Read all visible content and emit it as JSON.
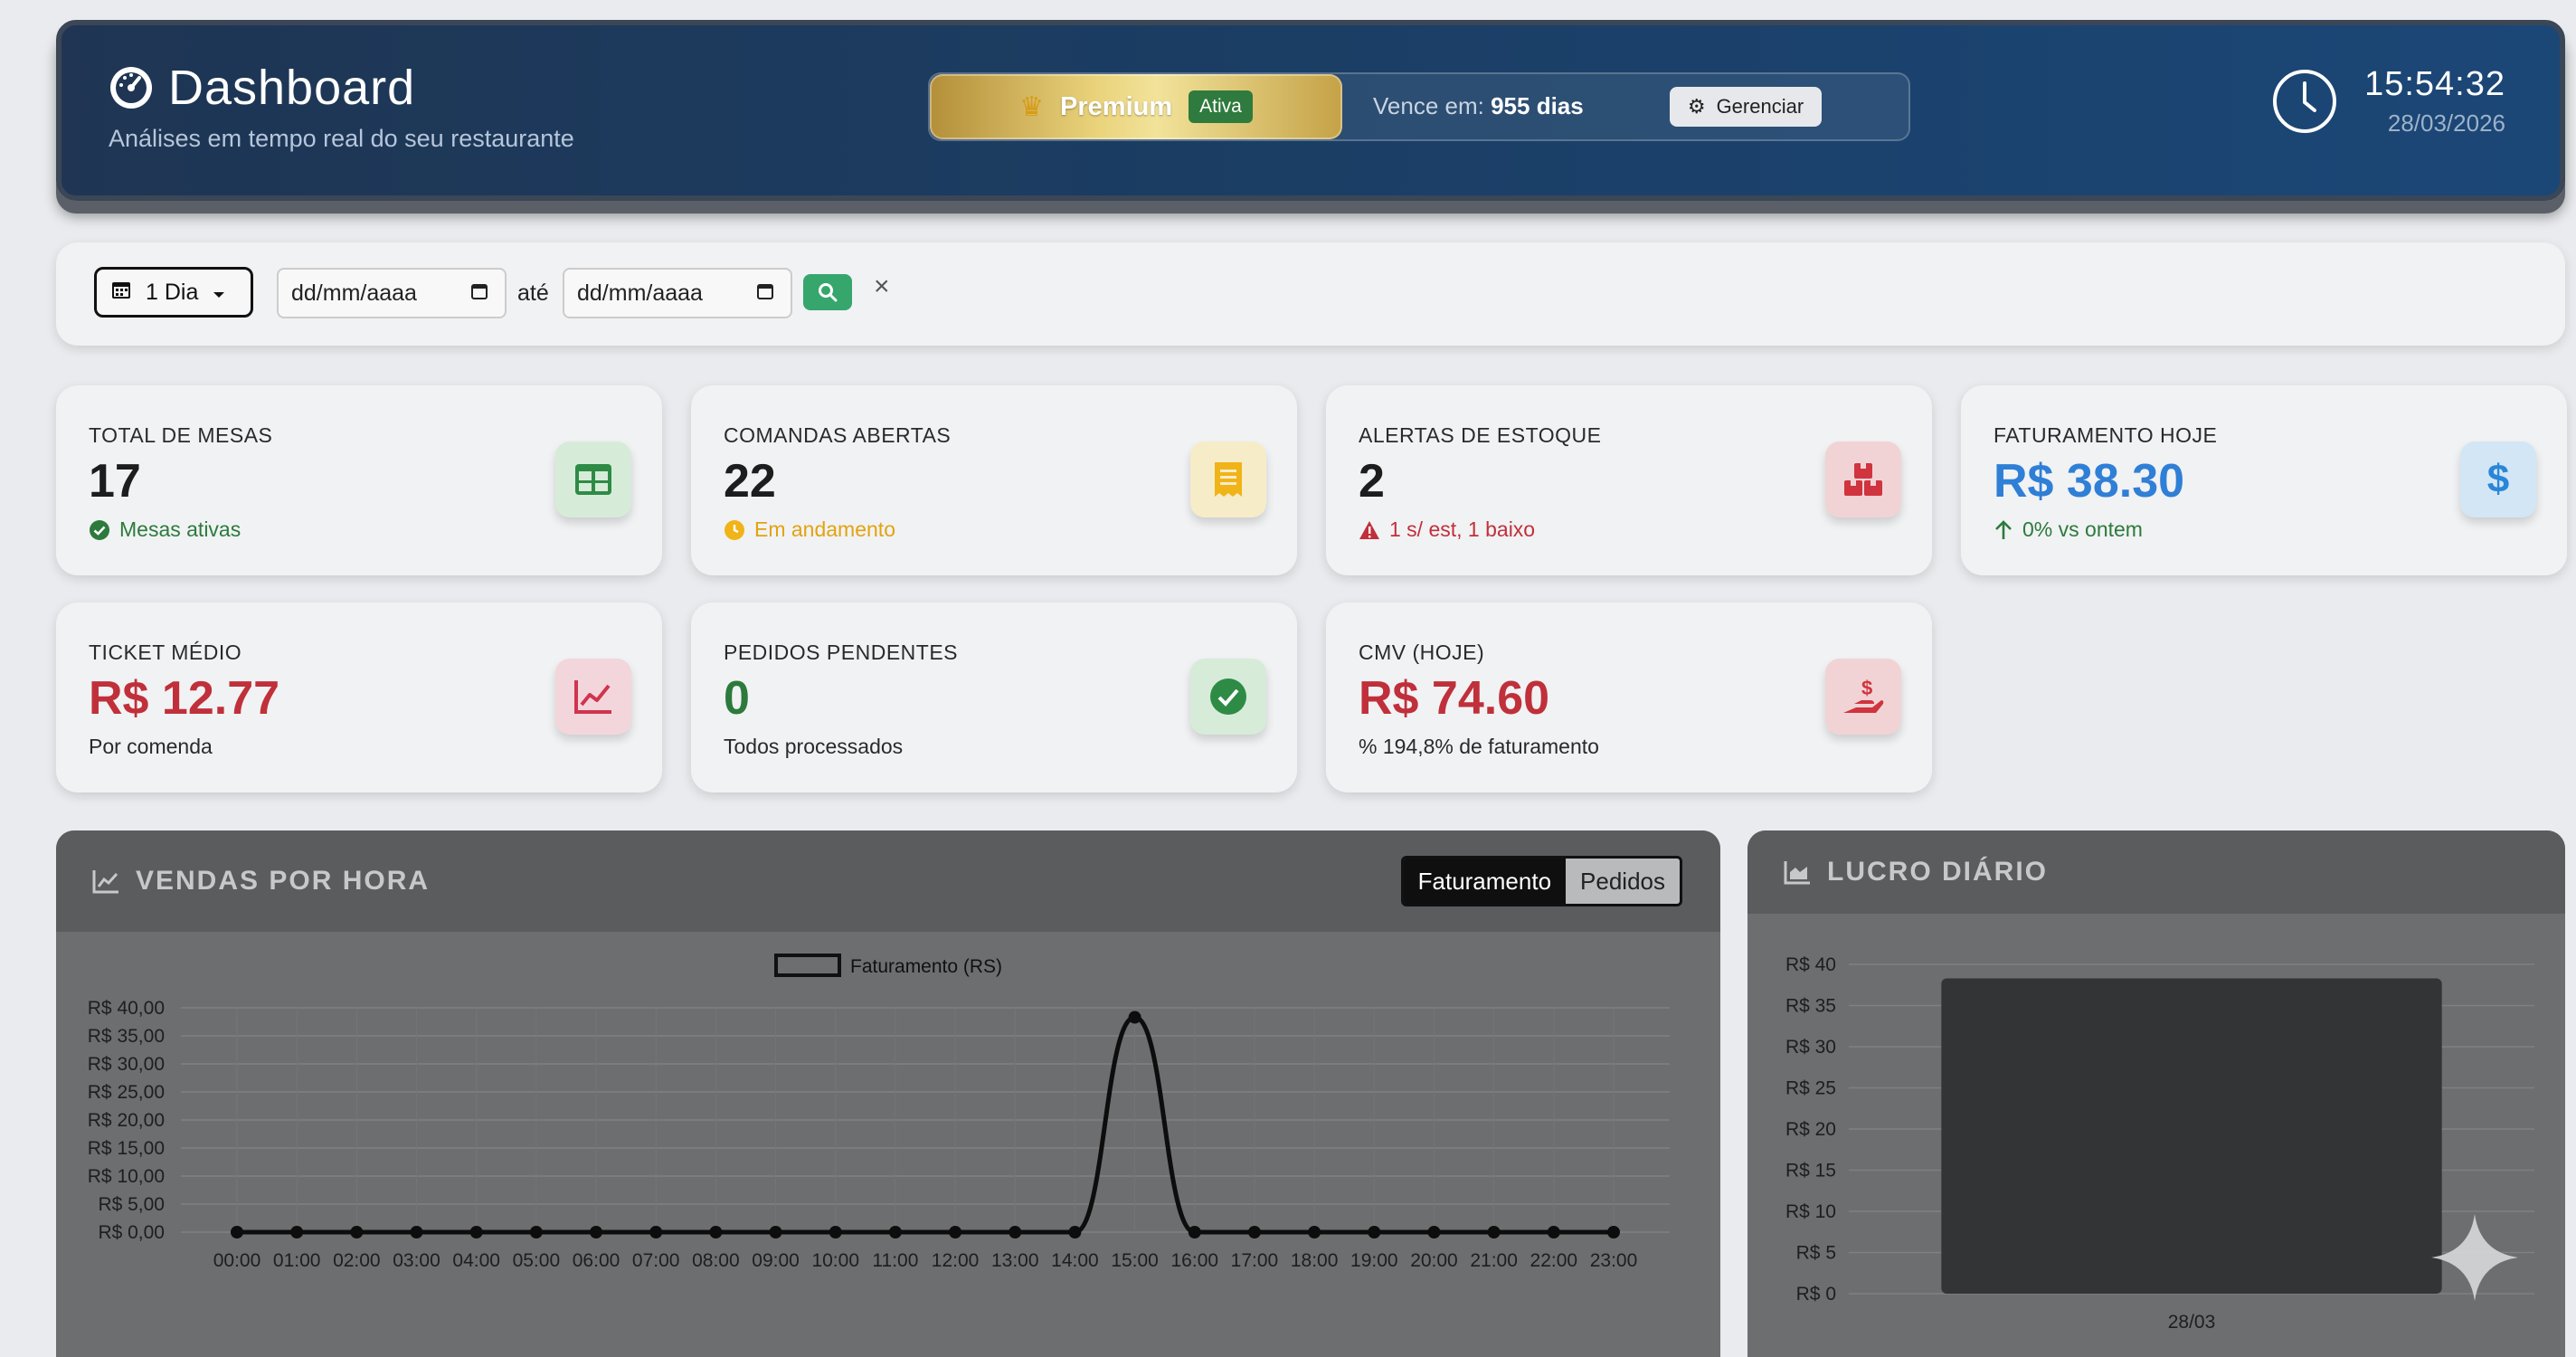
{
  "header": {
    "title": "Dashboard",
    "subtitle": "Análises em tempo real do seu restaurante",
    "plan": {
      "name": "Premium",
      "status_badge": "Ativa",
      "expires_label": "Vence em:",
      "expires_value": "955 dias",
      "manage_label": "Gerenciar"
    },
    "clock": {
      "time": "15:54:32",
      "date": "28/03/2026"
    }
  },
  "filter": {
    "period": "1 Dia",
    "start_placeholder": "dd/mm/aaaa",
    "until_label": "até",
    "end_placeholder": "dd/mm/aaaa",
    "clear_label": "×"
  },
  "cards": [
    {
      "label": "TOTAL DE MESAS",
      "value": "17",
      "sub": "Mesas ativas",
      "icon": "table-icon",
      "value_color": "#1d1d1d",
      "sub_color": "#2c7a3c",
      "icon_bg": "#d7ebd9",
      "icon_color": "#2e8b46"
    },
    {
      "label": "COMANDAS ABERTAS",
      "value": "22",
      "sub": "Em andamento",
      "icon": "receipt-icon",
      "value_color": "#1d1d1d",
      "sub_color": "#e2a30e",
      "icon_bg": "#f7ecc8",
      "icon_color": "#f0b419"
    },
    {
      "label": "ALERTAS DE ESTOQUE",
      "value": "2",
      "sub": "1 s/ est, 1 baixo",
      "icon": "boxes-icon",
      "value_color": "#1d1d1d",
      "sub_color": "#c0303a",
      "icon_bg": "#f2d3d5",
      "icon_color": "#d0343e"
    },
    {
      "label": "FATURAMENTO HOJE",
      "value": "R$ 38.30",
      "sub": "0% vs ontem",
      "icon": "dollar-icon",
      "value_color": "#2f7fd6",
      "sub_color": "#2c7a3c",
      "icon_bg": "#d3e6f5",
      "icon_color": "#2a86d8"
    },
    {
      "label": "TICKET MÉDIO",
      "value": "R$ 12.77",
      "sub": "Por comenda",
      "icon": "line-chart-icon",
      "value_color": "#c0303a",
      "sub_color": "#2a2a2a",
      "icon_bg": "#f3d6dc",
      "icon_color": "#d0344e"
    },
    {
      "label": "PEDIDOS PENDENTES",
      "value": "0",
      "sub": "Todos processados",
      "icon": "check-circle-icon",
      "value_color": "#2c7a3c",
      "sub_color": "#2a2a2a",
      "icon_bg": "#d7ebd9",
      "icon_color": "#2e8b46"
    },
    {
      "label": "CMV (HOJE)",
      "value": "R$ 74.60",
      "sub": "% 194,8% de faturamento",
      "icon": "hand-dollar-icon",
      "value_color": "#c0303a",
      "sub_color": "#2a2a2a",
      "icon_bg": "#f2d3d5",
      "icon_color": "#d0343e"
    }
  ],
  "sales_panel": {
    "title": "VENDAS POR HORA",
    "toggle": [
      "Faturamento",
      "Pedidos"
    ],
    "active_toggle": "Faturamento"
  },
  "profit_panel": {
    "title": "LUCRO DIÁRIO"
  },
  "chart_data": [
    {
      "type": "line",
      "legend": "Faturamento (RS)",
      "legend_position": "top",
      "x": [
        "00:00",
        "01:00",
        "02:00",
        "03:00",
        "04:00",
        "05:00",
        "06:00",
        "07:00",
        "08:00",
        "09:00",
        "10:00",
        "11:00",
        "12:00",
        "13:00",
        "14:00",
        "15:00",
        "16:00",
        "17:00",
        "18:00",
        "19:00",
        "20:00",
        "21:00",
        "22:00",
        "23:00"
      ],
      "series": [
        {
          "name": "Faturamento (RS)",
          "values": [
            0,
            0,
            0,
            0,
            0,
            0,
            0,
            0,
            0,
            0,
            0,
            0,
            0,
            0,
            0,
            38.3,
            0,
            0,
            0,
            0,
            0,
            0,
            0,
            0
          ]
        }
      ],
      "ylim": [
        0,
        40
      ],
      "yticks": [
        0,
        5,
        10,
        15,
        20,
        25,
        30,
        35,
        40
      ],
      "ytick_labels": [
        "R$ 0,00",
        "R$ 5,00",
        "R$ 10,00",
        "R$ 15,00",
        "R$ 20,00",
        "R$ 25,00",
        "R$ 30,00",
        "R$ 35,00",
        "R$ 40,00"
      ],
      "grid": true
    },
    {
      "type": "bar",
      "categories": [
        "28/03"
      ],
      "values": [
        38.3
      ],
      "ylim": [
        0,
        40
      ],
      "yticks": [
        0,
        5,
        10,
        15,
        20,
        25,
        30,
        35,
        40
      ],
      "ytick_labels": [
        "R$ 0",
        "R$ 5",
        "R$ 10",
        "R$ 15",
        "R$ 20",
        "R$ 25",
        "R$ 30",
        "R$ 35",
        "R$ 40"
      ],
      "grid": true
    }
  ]
}
